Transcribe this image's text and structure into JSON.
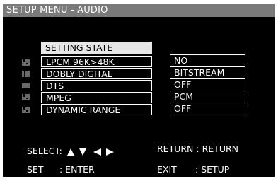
{
  "window": {
    "title": "SETUP MENU - AUDIO"
  },
  "menu": {
    "header": "SETTING STATE",
    "items": [
      {
        "label": "LPCM 96K>48K",
        "icon": "speaker-icon"
      },
      {
        "label": "DOBLY DIGITAL",
        "icon": "grid-icon"
      },
      {
        "label": "DTS",
        "icon": "bar-icon"
      },
      {
        "label": "MPEG",
        "icon": "speaker-icon"
      },
      {
        "label": "DYNAMIC RANGE",
        "icon": "speaker-icon"
      }
    ]
  },
  "values": [
    {
      "label": "NO"
    },
    {
      "label": "BITSTREAM"
    },
    {
      "label": "OFF"
    },
    {
      "label": "PCM"
    },
    {
      "label": "OFF"
    }
  ],
  "footer": {
    "select_label": "SELECT:",
    "return_key": "RETURN",
    "return_sep": ":",
    "return_action": "RETURN",
    "set_key": "SET",
    "set_action": ": ENTER",
    "exit_key": "EXIT",
    "exit_action": ": SETUP"
  },
  "colors": {
    "background": "#000000",
    "title_bar": "#7a7a7a",
    "header_highlight": "#e6e6e6",
    "text": "#ffffff"
  }
}
